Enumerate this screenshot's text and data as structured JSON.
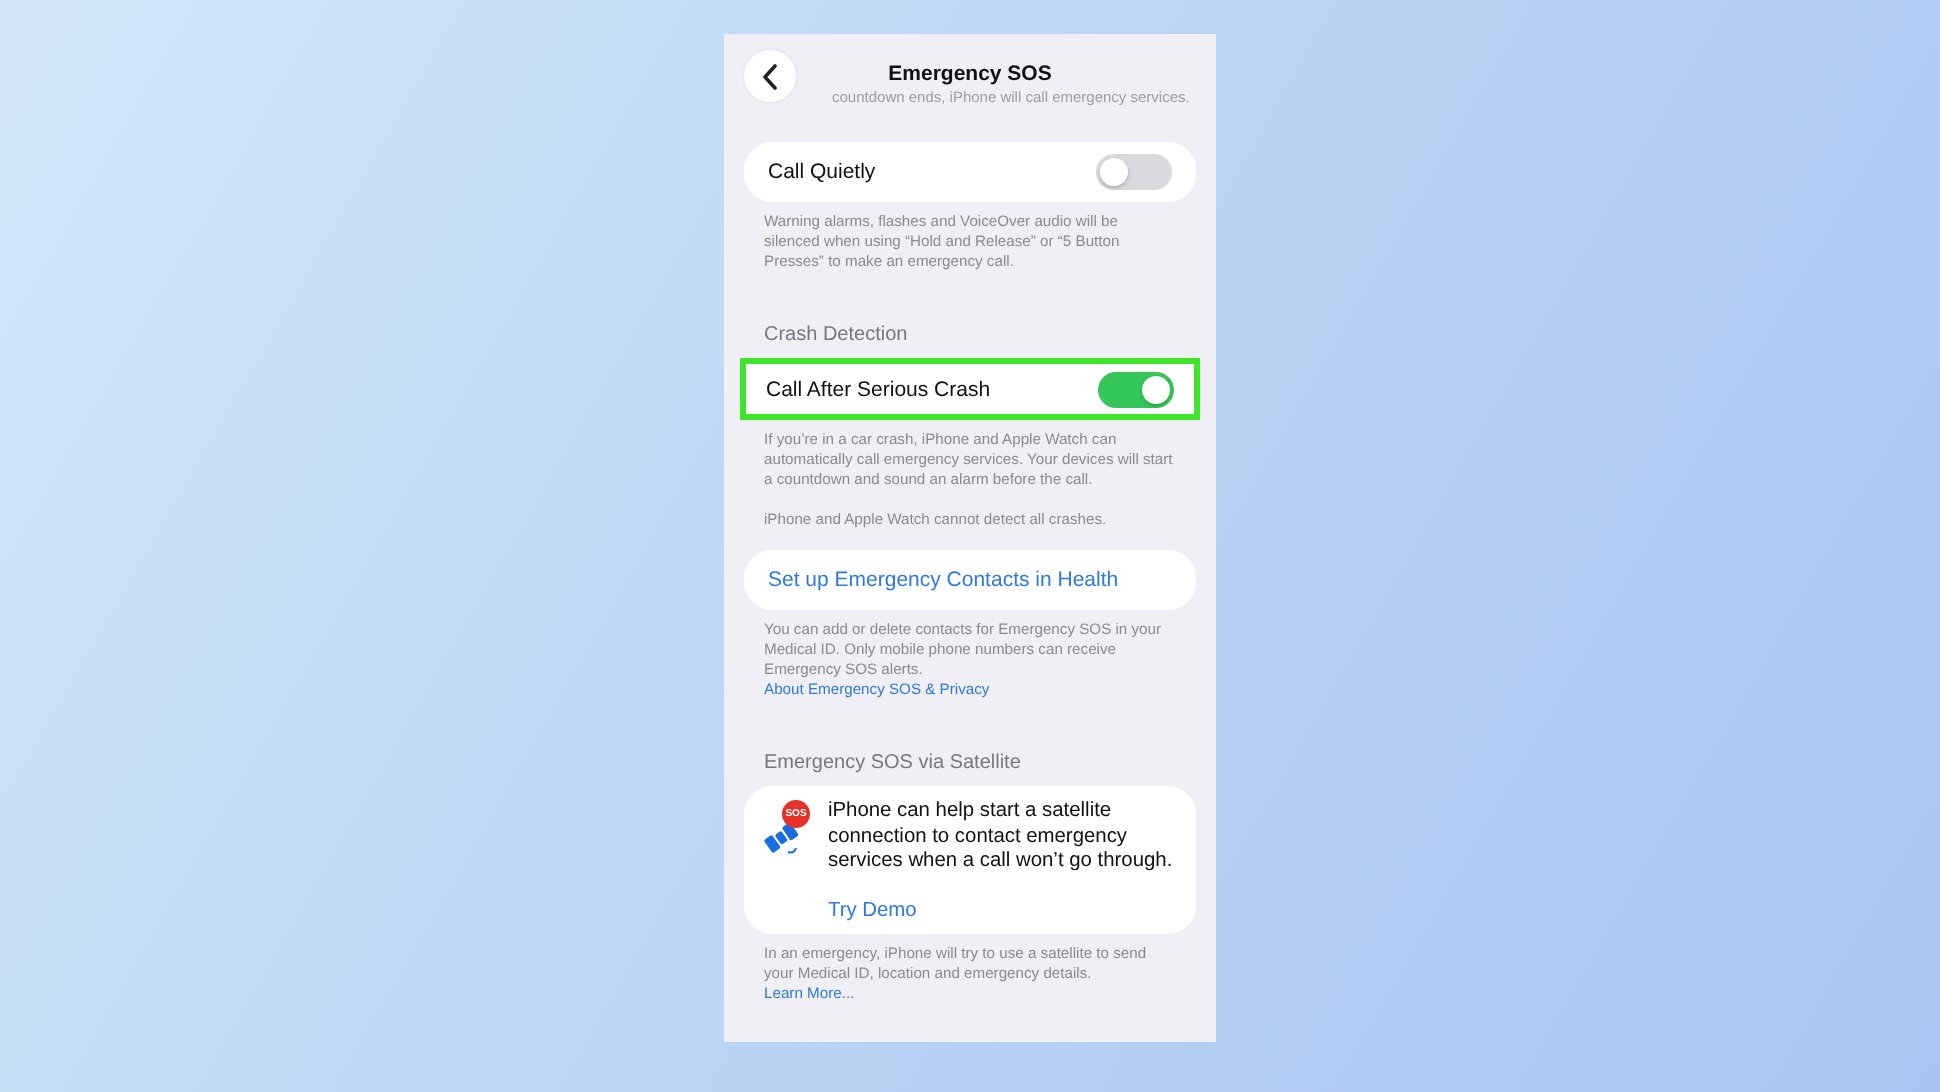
{
  "nav": {
    "title": "Emergency SOS",
    "scrolled_text": "countdown ends, iPhone will call emergency services."
  },
  "sections": [
    {
      "cells": [
        {
          "kind": "toggle",
          "label": "Call Quietly",
          "on": false,
          "highlighted": false
        }
      ],
      "footer": [
        {
          "text": "Warning alarms, flashes and VoiceOver audio will be silenced when using “Hold and Release” or “5 Button Presses” to make an emergency call."
        }
      ]
    },
    {
      "header": "Crash Detection",
      "cells": [
        {
          "kind": "toggle",
          "label": "Call After Serious Crash",
          "on": true,
          "highlighted": true
        }
      ],
      "footer": [
        {
          "text": "If you’re in a car crash, iPhone and Apple Watch can automatically call emergency services. Your devices will start a countdown and sound an alarm before the call."
        },
        {
          "text": "iPhone and Apple Watch cannot detect all crashes."
        }
      ]
    },
    {
      "cells": [
        {
          "kind": "link",
          "label": "Set up Emergency Contacts in Health"
        }
      ],
      "footer": [
        {
          "text": "You can add or delete contacts for Emergency SOS in your Medical ID. Only mobile phone numbers can receive Emergency SOS alerts.",
          "link": "About Emergency SOS & Privacy"
        }
      ]
    },
    {
      "header": "Emergency SOS via Satellite",
      "cells": [
        {
          "kind": "satellite",
          "badge": "SOS",
          "label": "iPhone can help start a satellite connection to contact emergency services when a call won’t go through.",
          "action": "Try Demo"
        }
      ],
      "footer": [
        {
          "text": "In an emergency, iPhone will try to use a satellite to send your Medical ID, location and emergency details.",
          "link": "Learn More..."
        }
      ]
    }
  ]
}
